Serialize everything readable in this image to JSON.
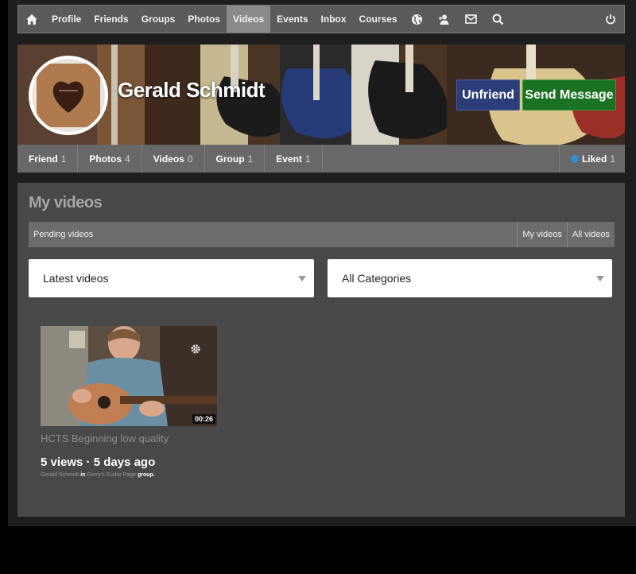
{
  "nav": {
    "items": [
      {
        "label": "Profile"
      },
      {
        "label": "Friends"
      },
      {
        "label": "Groups"
      },
      {
        "label": "Photos"
      },
      {
        "label": "Videos",
        "active": true
      },
      {
        "label": "Events"
      },
      {
        "label": "Inbox"
      },
      {
        "label": "Courses"
      }
    ],
    "icons": [
      "home-icon",
      "globe-icon",
      "friend-requests-icon",
      "mail-icon",
      "search-icon",
      "power-icon"
    ]
  },
  "profile": {
    "name": "Gerald Schmidt",
    "unfriend_label": "Unfriend",
    "send_message_label": "Send Message"
  },
  "profile_tabs": [
    {
      "label": "Friend",
      "count": "1"
    },
    {
      "label": "Photos",
      "count": "4"
    },
    {
      "label": "Videos",
      "count": "0"
    },
    {
      "label": "Group",
      "count": "1"
    },
    {
      "label": "Event",
      "count": "1"
    }
  ],
  "liked": {
    "label": "Liked",
    "count": "1"
  },
  "main": {
    "title": "My videos",
    "subnav": {
      "pending": "Pending videos",
      "my_videos": "My videos",
      "all_videos": "All videos"
    },
    "sort_select": "Latest videos",
    "category_select": "All Categories"
  },
  "video": {
    "duration": "00:26",
    "title": "HCTS Beginning low quality",
    "stats": "5 views · 5 days ago",
    "author": "Gerald Schmidt",
    "in_word": "in",
    "group_name": "Gerry's Guitar Page",
    "group_word": "group."
  },
  "colors": {
    "nav_bg": "#5a5a5a",
    "active_tab": "#8a8a8a",
    "unfriend": "#2c3e7a",
    "send_message": "#1a7322",
    "panel_bg": "#484848",
    "liked_dot": "#2d8fd6"
  }
}
